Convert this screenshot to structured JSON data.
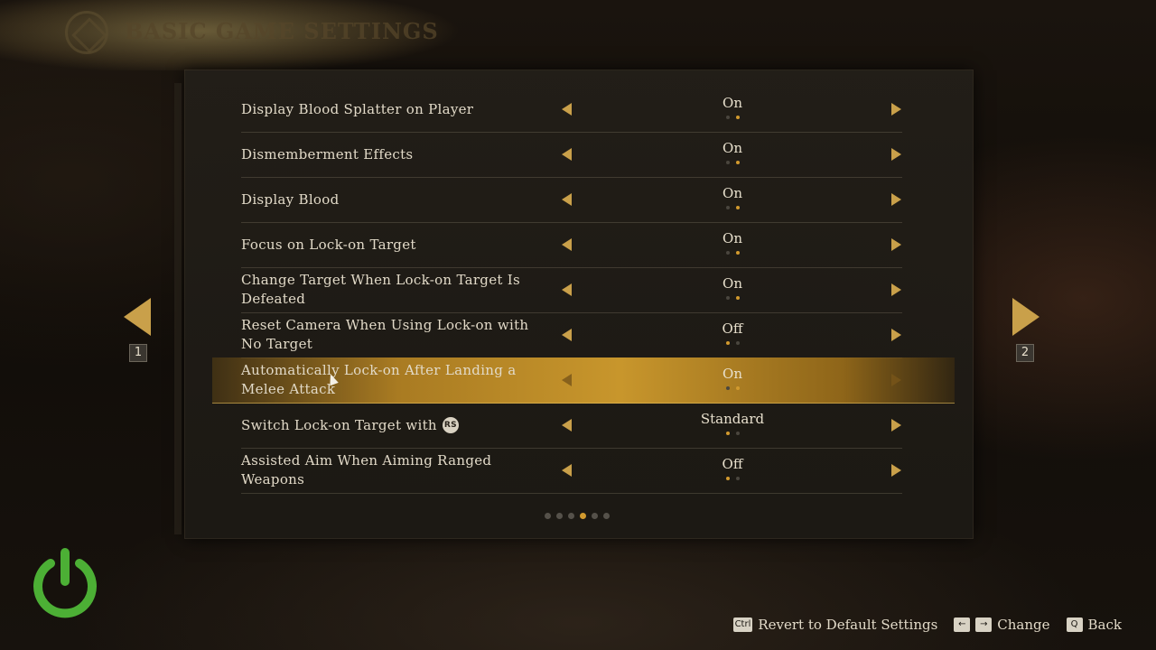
{
  "header": {
    "title": "BASIC GAME SETTINGS"
  },
  "settings": [
    {
      "label": "Display Blood Splatter on Player",
      "value": "On",
      "option_index": 1,
      "option_count": 2
    },
    {
      "label": "Dismemberment Effects",
      "value": "On",
      "option_index": 1,
      "option_count": 2
    },
    {
      "label": "Display Blood",
      "value": "On",
      "option_index": 1,
      "option_count": 2
    },
    {
      "label": "Focus on Lock-on Target",
      "value": "On",
      "option_index": 1,
      "option_count": 2
    },
    {
      "label": "Change Target When Lock-on Target Is Defeated",
      "value": "On",
      "option_index": 1,
      "option_count": 2
    },
    {
      "label": "Reset Camera When Using Lock-on with No Target",
      "value": "Off",
      "option_index": 0,
      "option_count": 2
    },
    {
      "label": "Automatically Lock-on After Landing a Melee Attack",
      "value": "On",
      "option_index": 1,
      "option_count": 2,
      "selected": true
    },
    {
      "label": "Switch Lock-on Target with",
      "button_icon": "RS",
      "value": "Standard",
      "option_index": 0,
      "option_count": 2
    },
    {
      "label": "Assisted Aim When Aiming Ranged Weapons",
      "value": "Off",
      "option_index": 0,
      "option_count": 2
    }
  ],
  "pagination": {
    "page_count": 6,
    "current_page": 4
  },
  "nav": {
    "left_number": "1",
    "right_number": "2"
  },
  "footer": {
    "revert_key": "Ctrl",
    "revert_label": "Revert to Default Settings",
    "change_key_left": "←",
    "change_key_right": "→",
    "change_label": "Change",
    "back_key": "Q",
    "back_label": "Back"
  },
  "colors": {
    "accent": "#c9a04a",
    "selected_row": "#c8962c",
    "power_icon": "#4caf35"
  }
}
